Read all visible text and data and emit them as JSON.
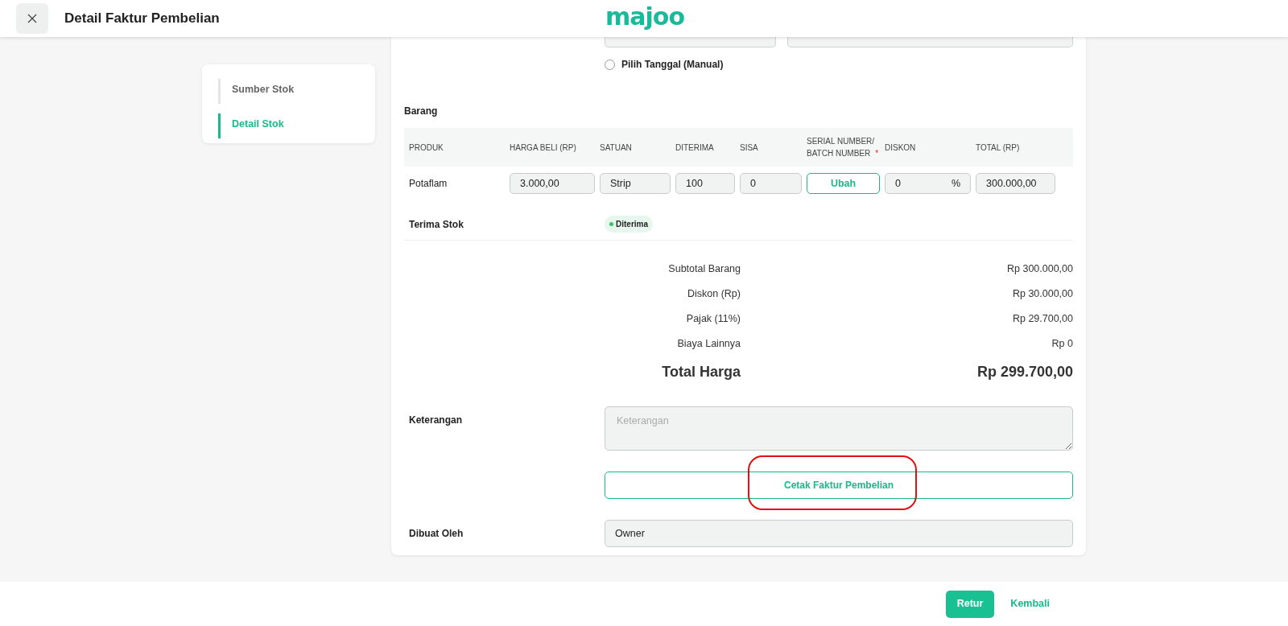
{
  "header": {
    "title": "Detail Faktur Pembelian",
    "logo": "majoo"
  },
  "steps": [
    {
      "label": "Sumber Stok",
      "selected": false
    },
    {
      "label": "Detail Stok",
      "selected": true
    }
  ],
  "date_option": {
    "label": "Pilih Tanggal (Manual)",
    "selected": false
  },
  "items": {
    "title": "Barang",
    "columns": [
      {
        "label": "PRODUK"
      },
      {
        "label": "HARGA BELI (RP)"
      },
      {
        "label": "SATUAN"
      },
      {
        "label": "DITERIMA"
      },
      {
        "label": "SISA"
      },
      {
        "label": "SERIAL NUMBER/ BATCH NUMBER",
        "required_mark": "*"
      },
      {
        "label": "DISKON"
      },
      {
        "label": "TOTAL (RP)"
      }
    ],
    "rows": [
      {
        "cells": [
          {
            "kind": "text",
            "value": "Potaflam"
          },
          {
            "kind": "input",
            "value": "3.000,00"
          },
          {
            "kind": "input",
            "value": "Strip"
          },
          {
            "kind": "input",
            "value": "100"
          },
          {
            "kind": "input",
            "value": "0"
          },
          {
            "kind": "button",
            "value": "Ubah"
          },
          {
            "kind": "suffix",
            "value": "0",
            "suffix": "%"
          },
          {
            "kind": "input",
            "value": "300.000,00"
          }
        ]
      }
    ]
  },
  "receive": {
    "label": "Terima Stok",
    "status": "Diterima",
    "color": "#3cc26a"
  },
  "summary": [
    {
      "label": "Subtotal Barang",
      "value": "Rp 300.000,00"
    },
    {
      "label": "Diskon (Rp)",
      "value": "Rp 30.000,00"
    },
    {
      "label": "Pajak (11%)",
      "value": "Rp 29.700,00"
    },
    {
      "label": "Biaya Lainnya",
      "value": "Rp 0"
    }
  ],
  "total": {
    "label": "Total Harga",
    "value": "Rp 299.700,00"
  },
  "notes": {
    "label": "Keterangan",
    "placeholder": "Keterangan"
  },
  "print_button": {
    "label": "Cetak Faktur Pembelian",
    "highlighted": true
  },
  "created_by": {
    "label": "Dibuat Oleh",
    "value": "Owner"
  },
  "footer_buttons": [
    {
      "kind": "primary",
      "label": "Retur"
    },
    {
      "kind": "link",
      "label": "Kembali"
    }
  ]
}
